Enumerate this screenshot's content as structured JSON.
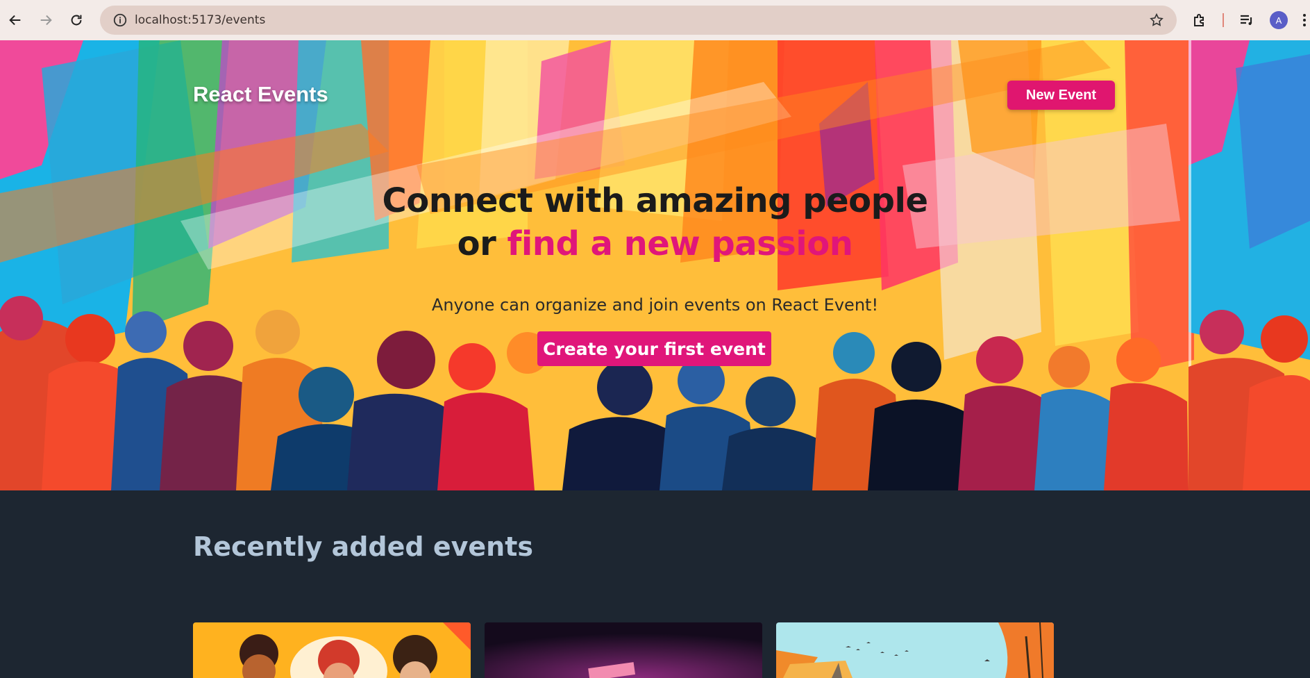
{
  "browser": {
    "url": "localhost:5173/events",
    "avatar_initial": "A",
    "icons": [
      "back-icon",
      "forward-icon",
      "reload-icon",
      "info-icon",
      "star-icon",
      "extensions-icon",
      "media-icon",
      "menu-icon"
    ]
  },
  "header": {
    "brand": "React Events",
    "new_event_label": "New Event"
  },
  "hero": {
    "headline_line1": "Connect with amazing people",
    "headline_or": "or ",
    "headline_accent": "find a new passion",
    "subtitle": "Anyone can organize and join events on React Event!",
    "cta_label": "Create your first event"
  },
  "recent": {
    "title": "Recently added events"
  },
  "colors": {
    "accent": "#e0167a",
    "section_bg": "#1d2631",
    "section_title": "#b3c6d9"
  }
}
